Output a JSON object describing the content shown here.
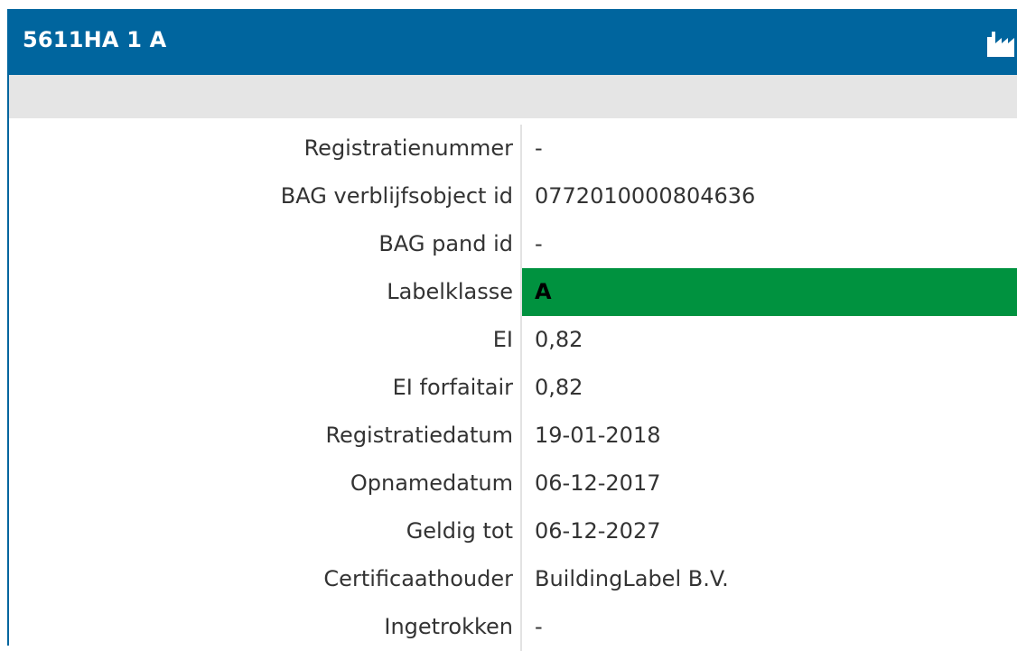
{
  "header": {
    "title": "5611HA 1 A",
    "icon": "factory-icon"
  },
  "colors": {
    "header_bg": "#00659e",
    "subbar_bg": "#e5e5e5",
    "label_class_bg": "#00923f"
  },
  "rows": [
    {
      "label": "Registratienummer",
      "value": "-"
    },
    {
      "label": "BAG verblijfsobject id",
      "value": "0772010000804636"
    },
    {
      "label": "BAG pand id",
      "value": "-"
    },
    {
      "label": "Labelklasse",
      "value": "A"
    },
    {
      "label": "EI",
      "value": "0,82"
    },
    {
      "label": "EI forfaitair",
      "value": "0,82"
    },
    {
      "label": "Registratiedatum",
      "value": "19-01-2018"
    },
    {
      "label": "Opnamedatum",
      "value": "06-12-2017"
    },
    {
      "label": "Geldig tot",
      "value": "06-12-2027"
    },
    {
      "label": "Certificaathouder",
      "value": "BuildingLabel B.V."
    },
    {
      "label": "Ingetrokken",
      "value": "-"
    }
  ]
}
